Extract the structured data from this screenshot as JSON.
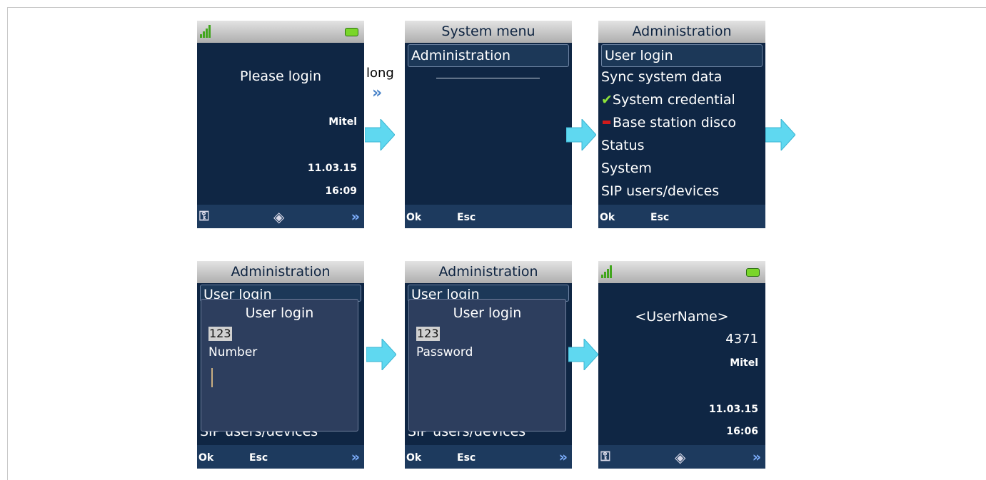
{
  "step_label": "long",
  "screen1": {
    "prompt": "Please login",
    "brand": "Mitel",
    "date": "11.03.15",
    "time": "16:09"
  },
  "screen2": {
    "title": "System menu",
    "item": "Administration",
    "soft_ok": "Ok",
    "soft_esc": "Esc"
  },
  "screen3": {
    "title": "Administration",
    "items": [
      "User login",
      "Sync system data",
      "System credential",
      "Base station disco",
      "Status",
      "System",
      "SIP users/devices"
    ],
    "soft_ok": "Ok",
    "soft_esc": "Esc"
  },
  "screen4": {
    "title": "Administration",
    "bg_top": "User login",
    "bg_bottom": "SIP users/devices",
    "dialog_title": "User login",
    "input_mode": "123",
    "field": "Number",
    "soft_ok": "Ok",
    "soft_esc": "Esc"
  },
  "screen5": {
    "title": "Administration",
    "bg_top": "User login",
    "bg_bottom": "SIP users/devices",
    "dialog_title": "User login",
    "input_mode": "123",
    "field": "Password",
    "soft_ok": "Ok",
    "soft_esc": "Esc"
  },
  "screen6": {
    "username": "<UserName>",
    "number": "4371",
    "brand": "Mitel",
    "date": "11.03.15",
    "time": "16:06"
  },
  "icons": {
    "arrow": "cyan-right-arrow-icon",
    "forward": "double-chevron-icon",
    "key": "key-icon",
    "nav": "navigation-icon",
    "check": "checkmark-icon",
    "minus": "red-minus-icon",
    "signal": "signal-icon",
    "battery": "battery-icon"
  },
  "colors": {
    "screen_bg": "#0f2644",
    "softbar_bg": "#1d3a5e",
    "arrow": "#5fd8f0",
    "dialog_bg": "#2d3e5e"
  }
}
